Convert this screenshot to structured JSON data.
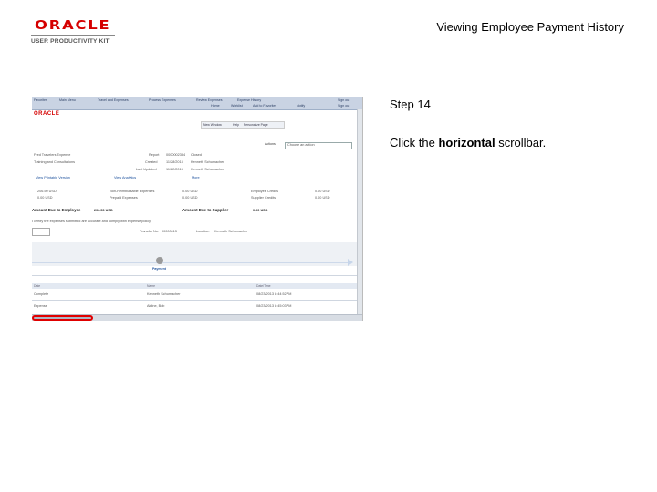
{
  "header": {
    "logo_oracle": "ORACLE",
    "logo_upk": "USER PRODUCTIVITY KIT",
    "doc_title": "Viewing Employee Payment History"
  },
  "instructions": {
    "step": "Step 14",
    "text_before": "Click the ",
    "text_bold": "horizontal",
    "text_after": " scrollbar."
  },
  "screenshot": {
    "menu_row1": [
      "Favorites",
      "Main Menu",
      "Travel and Expenses",
      "Process Expenses",
      "Review Expenses",
      "Expense History",
      "Sign out"
    ],
    "menu_row2": [
      "Home",
      "Worklist",
      "Add to Favorites",
      "Notify",
      "Sign out"
    ],
    "logo": "ORACLE",
    "links": [
      "New Window",
      "Help",
      "Personalize Page"
    ],
    "actions_label": "Actions",
    "actions_value": "Choose an action",
    "report_label": "Report",
    "report_value": "0000002334",
    "report_status": "Closed",
    "created_label": "Created",
    "created_value": "11/28/2013",
    "created_by": "Kenneth Schumacher",
    "updated_label": "Last Updated",
    "updated_value": "11/22/2013",
    "updated_by": "Kenneth Schumacher",
    "left_line1": "Fred Travelers Expense",
    "left_line2": "Training and Consultations",
    "view_link": "View Printable Version",
    "analytics_link": "View Analytics",
    "more_link": "More",
    "amounts_row1": [
      "206.50 USD",
      "Non-Reimbursable Expenses",
      "0.00 USD",
      "Employee Credits",
      "0.00 USD"
    ],
    "amounts_row2": [
      "0.00 USD",
      "Prepaid Expenses",
      "0.00 USD",
      "Supplier Credits",
      "0.00 USD"
    ],
    "due_employee_label": "Amount Due to Employee",
    "due_employee_value": "206.50 USD",
    "due_supplier_label": "Amount Due to Supplier",
    "due_supplier_value": "0.00 USD",
    "policy_text": "I certify the expenses submitted are accurate and comply with expense policy.",
    "transfer_label": "Transfer No.",
    "transfer_value": "00000013",
    "location_label": "Location",
    "location_value": "Kenneth Schumacher",
    "node_label": "Payment",
    "table_headers": [
      "Date",
      "Name",
      "Date/Time"
    ],
    "rows": [
      [
        "Complete",
        "Kenneth Schumacher",
        "08/23/2013 8:44:52PM"
      ],
      [
        "Expense",
        "Airline, Bob",
        "08/23/2013 8:45:03PM"
      ]
    ]
  }
}
